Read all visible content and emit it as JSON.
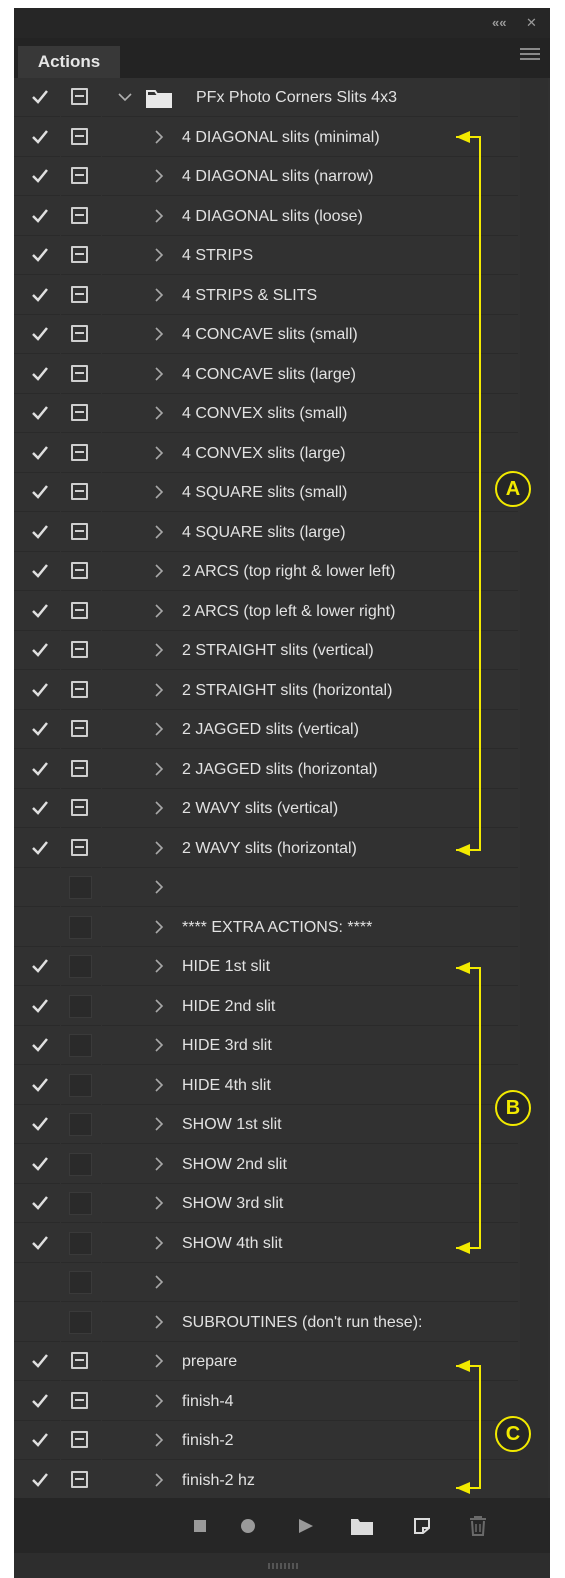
{
  "panel": {
    "tab_label": "Actions",
    "collapse_glyph": "««",
    "close_glyph": "✕"
  },
  "action_set": {
    "name": "PFx Photo Corners Slits 4x3"
  },
  "actions": [
    {
      "label": "4 DIAGONAL slits (minimal)",
      "checked": true,
      "dialog": true
    },
    {
      "label": "4 DIAGONAL slits (narrow)",
      "checked": true,
      "dialog": true
    },
    {
      "label": "4 DIAGONAL slits (loose)",
      "checked": true,
      "dialog": true
    },
    {
      "label": "4 STRIPS",
      "checked": true,
      "dialog": true
    },
    {
      "label": "4 STRIPS & SLITS",
      "checked": true,
      "dialog": true
    },
    {
      "label": "4 CONCAVE slits (small)",
      "checked": true,
      "dialog": true
    },
    {
      "label": "4 CONCAVE slits (large)",
      "checked": true,
      "dialog": true
    },
    {
      "label": "4 CONVEX slits (small)",
      "checked": true,
      "dialog": true
    },
    {
      "label": "4 CONVEX slits (large)",
      "checked": true,
      "dialog": true
    },
    {
      "label": "4 SQUARE slits (small)",
      "checked": true,
      "dialog": true
    },
    {
      "label": "4 SQUARE slits (large)",
      "checked": true,
      "dialog": true
    },
    {
      "label": "2 ARCS (top right & lower left)",
      "checked": true,
      "dialog": true
    },
    {
      "label": "2 ARCS (top left & lower right)",
      "checked": true,
      "dialog": true
    },
    {
      "label": "2 STRAIGHT slits (vertical)",
      "checked": true,
      "dialog": true
    },
    {
      "label": "2 STRAIGHT slits (horizontal)",
      "checked": true,
      "dialog": true
    },
    {
      "label": "2 JAGGED slits (vertical)",
      "checked": true,
      "dialog": true
    },
    {
      "label": "2 JAGGED slits (horizontal)",
      "checked": true,
      "dialog": true
    },
    {
      "label": "2 WAVY slits (vertical)",
      "checked": true,
      "dialog": true
    },
    {
      "label": "2 WAVY slits (horizontal)",
      "checked": true,
      "dialog": true
    },
    {
      "label": "",
      "checked": false,
      "dialog": false
    },
    {
      "label": "**** EXTRA ACTIONS: ****",
      "checked": false,
      "dialog": false
    },
    {
      "label": "HIDE 1st slit",
      "checked": true,
      "dialog": false
    },
    {
      "label": "HIDE 2nd slit",
      "checked": true,
      "dialog": false
    },
    {
      "label": "HIDE 3rd slit",
      "checked": true,
      "dialog": false
    },
    {
      "label": "HIDE 4th slit",
      "checked": true,
      "dialog": false
    },
    {
      "label": "SHOW 1st slit",
      "checked": true,
      "dialog": false
    },
    {
      "label": "SHOW 2nd slit",
      "checked": true,
      "dialog": false
    },
    {
      "label": "SHOW 3rd slit",
      "checked": true,
      "dialog": false
    },
    {
      "label": "SHOW 4th slit",
      "checked": true,
      "dialog": false
    },
    {
      "label": "",
      "checked": false,
      "dialog": false
    },
    {
      "label": "SUBROUTINES (don't run these):",
      "checked": false,
      "dialog": false
    },
    {
      "label": "prepare",
      "checked": true,
      "dialog": true
    },
    {
      "label": "finish-4",
      "checked": true,
      "dialog": true
    },
    {
      "label": "finish-2",
      "checked": true,
      "dialog": true
    },
    {
      "label": "finish-2 hz",
      "checked": true,
      "dialog": true
    }
  ],
  "toolbar": {
    "icons": [
      "stop-icon",
      "record-icon",
      "play-icon",
      "new-set-folder-icon",
      "new-action-icon",
      "delete-icon"
    ]
  },
  "annotations": {
    "labels": [
      "A",
      "B",
      "C"
    ],
    "color": "#f2ea00"
  }
}
